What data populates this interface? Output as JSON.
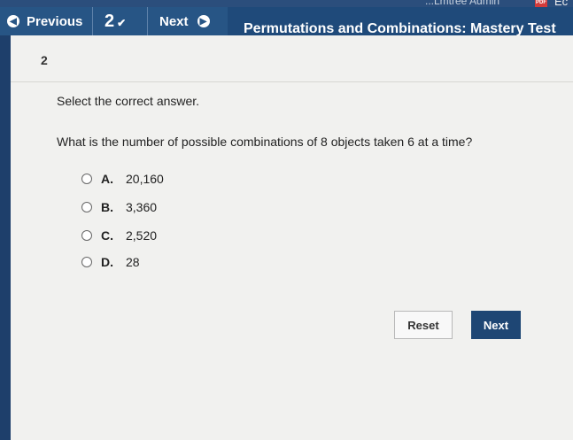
{
  "os_bar": {
    "faded_text": "...Lmtree Admin",
    "pdf_badge": "PDF",
    "partial_text": "Ec"
  },
  "toolbar": {
    "previous_label": "Previous",
    "question_number": "2",
    "next_label": "Next",
    "title": "Permutations and Combinations: Mastery Test"
  },
  "question": {
    "number": "2",
    "instruction": "Select the correct answer.",
    "prompt": "What is the number of possible combinations of 8 objects taken 6 at a time?",
    "options": [
      {
        "letter": "A.",
        "text": "20,160"
      },
      {
        "letter": "B.",
        "text": "3,360"
      },
      {
        "letter": "C.",
        "text": "2,520"
      },
      {
        "letter": "D.",
        "text": "28"
      }
    ]
  },
  "actions": {
    "reset_label": "Reset",
    "next_label": "Next"
  }
}
